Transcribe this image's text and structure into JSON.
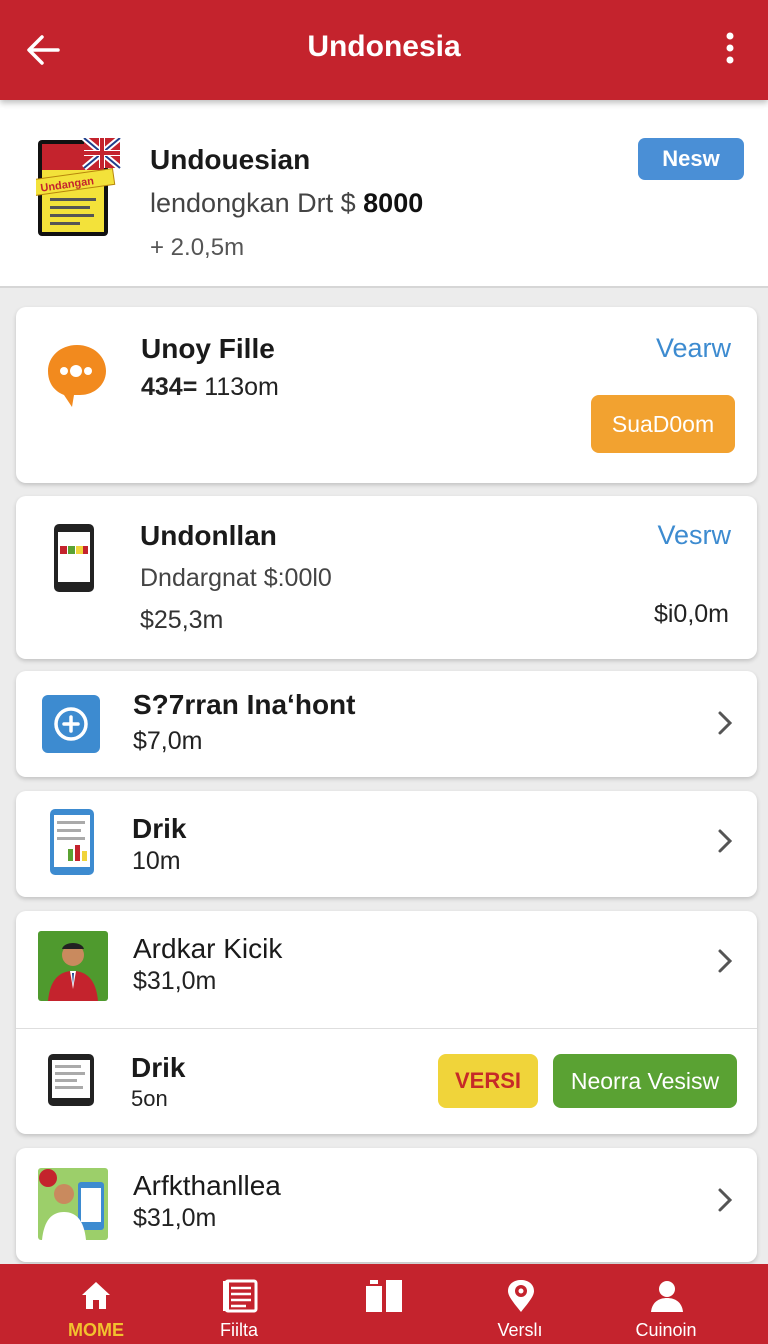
{
  "appbar": {
    "title": "Undonesia"
  },
  "hero": {
    "title": "Undouesian",
    "subtitle": "lendongkan Drt $",
    "subtitle_amount": "8000",
    "meta": "+ 2.0,5m",
    "badge": "Nesw",
    "thumb_text": "Undangan"
  },
  "cards": {
    "file": {
      "title": "Unoy Fille",
      "number": "434=",
      "value": "113om",
      "link": "Vearw",
      "button": "SuaD0om"
    },
    "undonllan": {
      "title": "Undonllan",
      "subtitle": "Dndargnat $:00l0",
      "amount": "$25,3m",
      "link": "Vesrw",
      "amount_right": "$i0,0m"
    },
    "s7rran": {
      "title": "S?7rran Inaʻhont",
      "amount": "$7,0m"
    },
    "drik1": {
      "title": "Drik",
      "amount": "10m"
    },
    "ardkar": {
      "title": "Ardkar Kicik",
      "amount": "$31,0m"
    },
    "drik2": {
      "title": "Drik",
      "amount": "5on",
      "btn_versi": "VERSI",
      "btn_view": "Neorra Vesisw"
    },
    "arfk": {
      "title": "Arfkthanllea",
      "amount": "$31,0m"
    }
  },
  "bottom_nav": [
    {
      "label": "MOME",
      "icon": "home-icon"
    },
    {
      "label": "Fiilta",
      "icon": "news-icon"
    },
    {
      "label": "",
      "icon": "columns-icon"
    },
    {
      "label": "Verslı",
      "icon": "location-icon"
    },
    {
      "label": "Cuinoin",
      "icon": "person-icon"
    }
  ],
  "colors": {
    "brand_red": "#c4232d",
    "accent_blue": "#4a8fd6",
    "accent_orange": "#f2a230",
    "accent_green": "#5aa233",
    "accent_yellow": "#f0d43a",
    "active_nav": "#f2c12e"
  }
}
